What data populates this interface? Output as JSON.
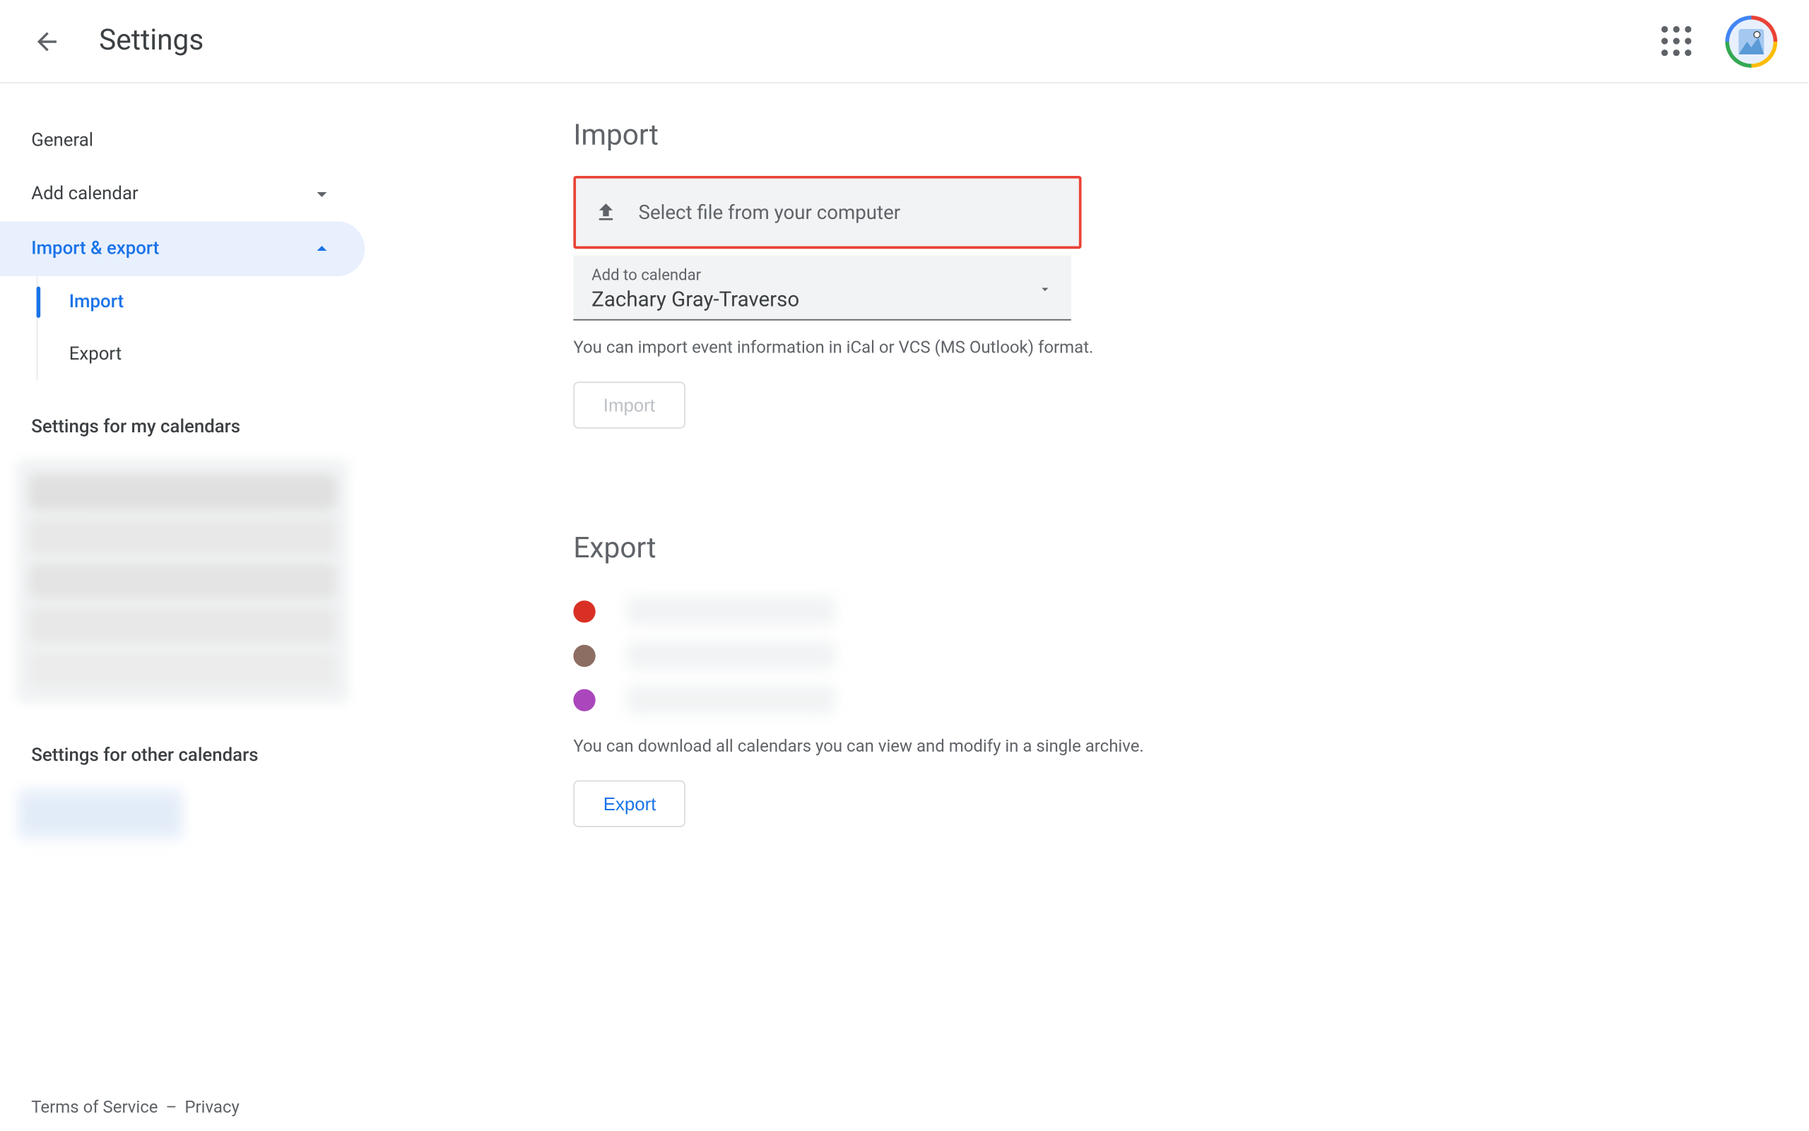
{
  "header": {
    "title": "Settings"
  },
  "sidebar": {
    "general": "General",
    "add_calendar": "Add calendar",
    "import_export": "Import & export",
    "sub_import": "Import",
    "sub_export": "Export",
    "heading_my": "Settings for my calendars",
    "heading_other": "Settings for other calendars"
  },
  "import": {
    "title": "Import",
    "file_label": "Select file from your computer",
    "dropdown_label": "Add to calendar",
    "dropdown_value": "Zachary Gray-Traverso",
    "helper": "You can import event information in iCal or VCS (MS Outlook) format.",
    "button": "Import"
  },
  "export": {
    "title": "Export",
    "calendars": [
      {
        "color": "#d93025"
      },
      {
        "color": "#8d6e63"
      },
      {
        "color": "#ab47bc"
      }
    ],
    "helper": "You can download all calendars you can view and modify in a single archive.",
    "button": "Export"
  },
  "footer": {
    "terms": "Terms of Service",
    "sep": "–",
    "privacy": "Privacy"
  }
}
